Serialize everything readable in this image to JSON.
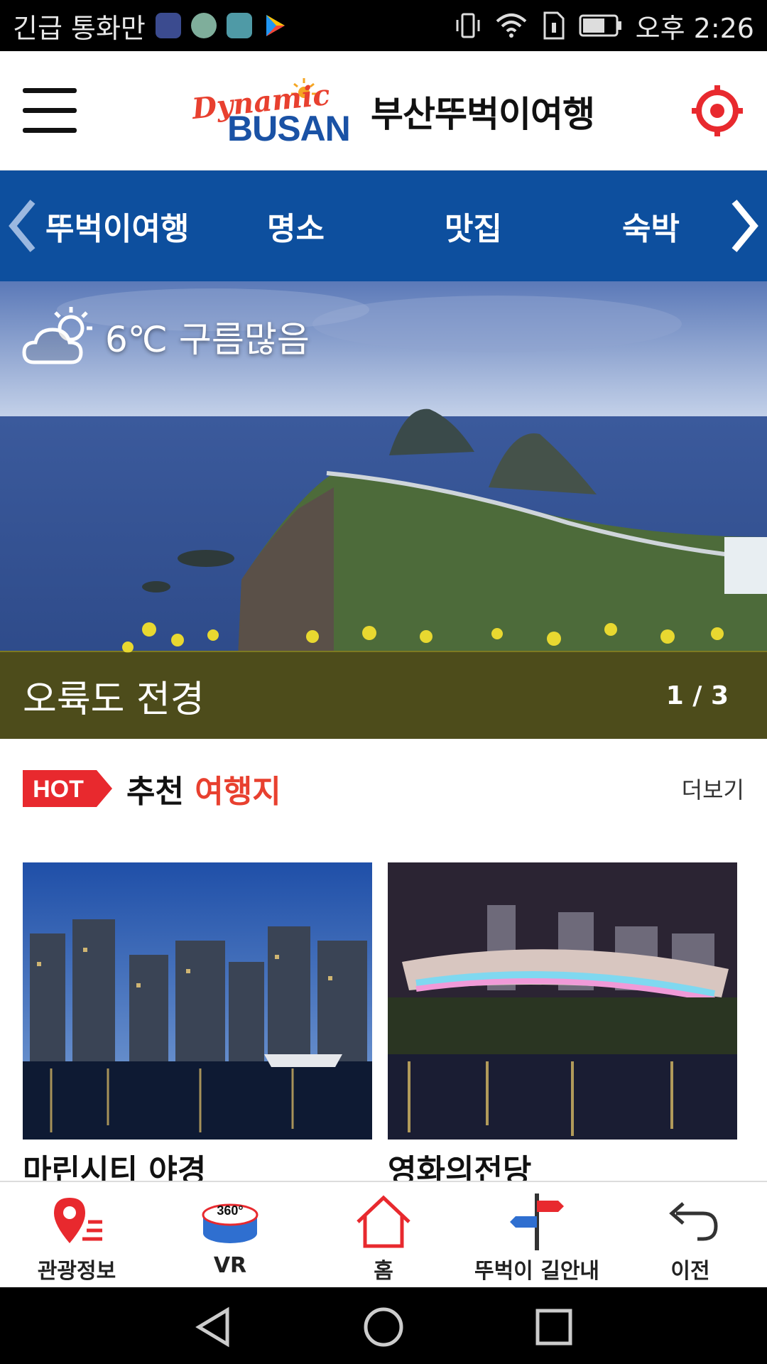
{
  "status_bar": {
    "left_text": "긴급 통화만",
    "time": "오후 2:26",
    "icons": [
      "location-app-icon",
      "avatar-app-icon",
      "shield-app-icon",
      "play-store-icon",
      "vibrate-icon",
      "wifi-icon",
      "sim-icon",
      "battery-icon"
    ]
  },
  "header": {
    "logo_line1": "Dynamic",
    "logo_line2": "BUSAN",
    "title": "부산뚜벅이여행",
    "menu_icon": "hamburger-menu-icon",
    "location_icon": "location-target-icon",
    "accent_color": "#e8402f",
    "brand_blue": "#1a52a5"
  },
  "category_nav": {
    "background": "#0d4f9e",
    "items": [
      {
        "label": "뚜벅이여행"
      },
      {
        "label": "명소"
      },
      {
        "label": "맛집"
      },
      {
        "label": "숙박"
      }
    ]
  },
  "hero": {
    "weather": {
      "temp": "6℃",
      "condition": "구름많음",
      "icon": "cloud-sun-icon"
    },
    "caption": "오륙도 전경",
    "counter": "1 / 3"
  },
  "section": {
    "badge": "HOT",
    "title_a": "추천",
    "title_b": "여행지",
    "more": "더보기"
  },
  "cards": [
    {
      "title": "마린시티 야경"
    },
    {
      "title": "영화의전당"
    }
  ],
  "tabbar": {
    "tabs": [
      {
        "label": "관광정보",
        "icon": "map-pin-list-icon"
      },
      {
        "label": "VR",
        "icon": "vr-360-icon",
        "icon_text": "360°"
      },
      {
        "label": "홈",
        "icon": "home-icon"
      },
      {
        "label": "뚜벅이 길안내",
        "icon": "signpost-icon"
      },
      {
        "label": "이전",
        "icon": "back-arrow-icon"
      }
    ]
  }
}
